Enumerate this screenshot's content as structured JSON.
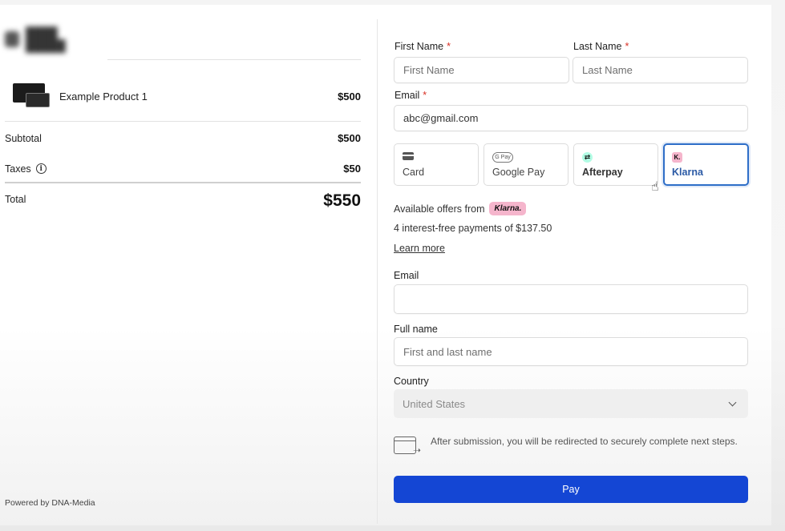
{
  "summary": {
    "product": {
      "name": "Example Product 1",
      "price": "$500"
    },
    "subtotal": {
      "label": "Subtotal",
      "value": "$500"
    },
    "taxes": {
      "label": "Taxes",
      "value": "$50"
    },
    "total": {
      "label": "Total",
      "value": "$550"
    },
    "powered_by": "Powered by DNA-Media"
  },
  "form": {
    "first_name": {
      "label": "First Name",
      "required": "*",
      "placeholder": "First Name"
    },
    "last_name": {
      "label": "Last Name",
      "required": "*",
      "placeholder": "Last Name"
    },
    "email": {
      "label": "Email",
      "required": "*",
      "value": "abc@gmail.com"
    }
  },
  "payment_methods": [
    {
      "label": "Card",
      "icon": "card-icon"
    },
    {
      "label": "Google Pay",
      "icon": "google-pay-icon",
      "icon_text": "G Pay"
    },
    {
      "label": "Afterpay",
      "icon": "afterpay-icon"
    },
    {
      "label": "Klarna",
      "icon": "klarna-icon",
      "icon_text": "K.",
      "selected": true
    }
  ],
  "klarna": {
    "offers_prefix": "Available offers from",
    "badge": "Klarna.",
    "installments": "4 interest-free payments of $137.50",
    "learn_more": "Learn more",
    "email_label": "Email",
    "email_value": "",
    "full_name_label": "Full name",
    "full_name_placeholder": "First and last name",
    "country_label": "Country",
    "country_value": "United States",
    "redirect_note": "After submission, you will be redirected to securely complete next steps."
  },
  "pay_button": "Pay",
  "colors": {
    "accent": "#1446d4",
    "selected_border": "#2e6ec8",
    "klarna_pink": "#f5b5cc",
    "required": "#d93025"
  }
}
